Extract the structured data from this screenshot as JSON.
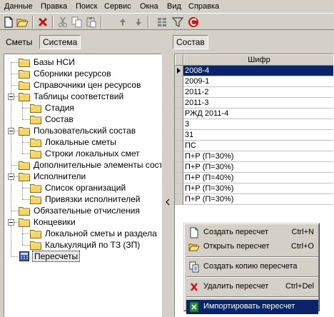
{
  "menu": [
    "Данные",
    "Правка",
    "Поиск",
    "Сервис",
    "Окна",
    "Вид",
    "Справка"
  ],
  "toolbar": {
    "icons": [
      "new-file-icon",
      "open-folder-icon",
      "delete-icon",
      "cut-icon",
      "copy-icon",
      "paste-icon",
      "move-up-icon",
      "move-down-icon",
      "grid-columns-icon",
      "filter-icon",
      "refresh-icon"
    ]
  },
  "tabs": {
    "left": [
      "Сметы",
      "Система"
    ],
    "right": "Состав"
  },
  "tree": [
    {
      "label": "Базы НСИ",
      "level": 0,
      "icon": "folder-icon"
    },
    {
      "label": "Сборники ресурсов",
      "level": 0,
      "icon": "folder-icon"
    },
    {
      "label": "Справочники цен ресурсов",
      "level": 0,
      "icon": "folder-icon"
    },
    {
      "label": "Таблицы соответствий",
      "level": 0,
      "icon": "folder-icon",
      "expanded": true
    },
    {
      "label": "Стадия",
      "level": 1,
      "icon": "folder-icon"
    },
    {
      "label": "Состав",
      "level": 1,
      "icon": "folder-icon"
    },
    {
      "label": "Пользовательский состав",
      "level": 0,
      "icon": "folder-icon",
      "expanded": true
    },
    {
      "label": "Локальные сметы",
      "level": 1,
      "icon": "folder-icon"
    },
    {
      "label": "Строки локальных смет",
      "level": 1,
      "icon": "folder-icon"
    },
    {
      "label": "Дополнительные элементы состав",
      "level": 0,
      "icon": "folder-icon"
    },
    {
      "label": "Исполнители",
      "level": 0,
      "icon": "folder-icon",
      "expanded": true
    },
    {
      "label": "Список организаций",
      "level": 1,
      "icon": "folder-icon"
    },
    {
      "label": "Привязки исполнителей",
      "level": 1,
      "icon": "folder-icon"
    },
    {
      "label": "Обязательные отчисления",
      "level": 0,
      "icon": "folder-icon"
    },
    {
      "label": "Концевики",
      "level": 0,
      "icon": "folder-icon",
      "expanded": true
    },
    {
      "label": "Локальной сметы и раздела",
      "level": 1,
      "icon": "folder-icon"
    },
    {
      "label": "Калькуляций по ТЗ (ЗП)",
      "level": 1,
      "icon": "folder-icon"
    },
    {
      "label": "Пересчеты",
      "level": 0,
      "icon": "calculator-icon",
      "selected": true
    }
  ],
  "grid": {
    "column": "Шифр",
    "rows": [
      "2008-4",
      "2009-1",
      "2011-2",
      "2011-3",
      "РЖД  2011-4",
      "3",
      "31",
      "ПС",
      "П+Р (П=30%)",
      "П+Р (П=30%)",
      "П+Р (П=40%)",
      "П+Р (П=30%)",
      "П+Р (П=30%)"
    ],
    "active_row": 0
  },
  "context_menu": {
    "items": [
      {
        "label": "Создать пересчет",
        "shortcut": "Ctrl+N",
        "icon": "new-document-icon"
      },
      {
        "label": "Открыть пересчет",
        "shortcut": "Ctrl+O",
        "icon": "open-folder-icon"
      },
      {
        "separator": true
      },
      {
        "label": "Создать копию пересчета",
        "shortcut": "",
        "icon": "copy-document-icon"
      },
      {
        "separator": true
      },
      {
        "label": "Удалить пересчет",
        "shortcut": "Ctrl+Del",
        "icon": "delete-icon"
      },
      {
        "separator": true
      },
      {
        "label": "Импортировать пересчет",
        "shortcut": "",
        "icon": "import-icon",
        "highlighted": true
      }
    ]
  },
  "colors": {
    "window_bg": "#d4d0c8",
    "selection": "#0a246a",
    "folder": "#f4d56c"
  }
}
